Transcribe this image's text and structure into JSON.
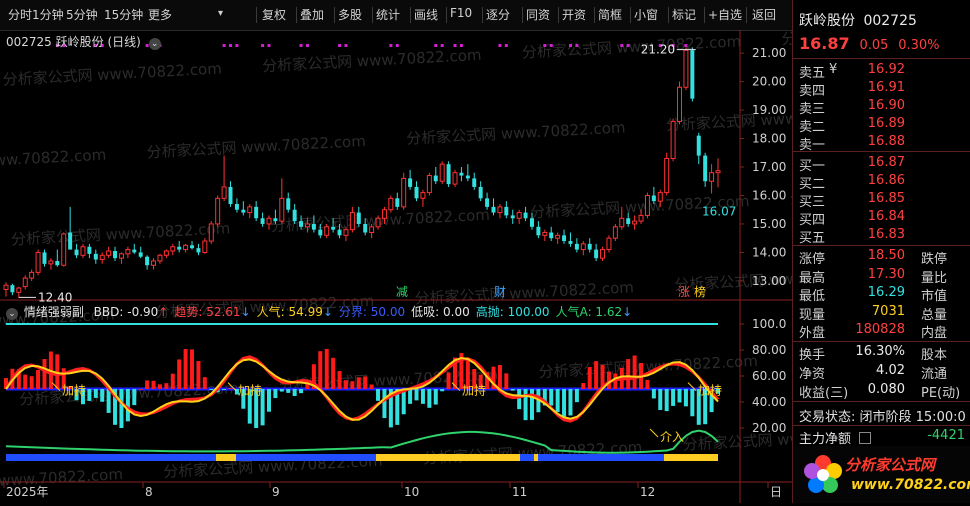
{
  "toolbar": {
    "items": [
      "分时",
      "1分钟",
      "5分钟",
      "15分钟",
      "更多",
      "复权",
      "叠加",
      "多股",
      "统计",
      "画线",
      "F10",
      "逐分",
      "同资",
      "开资",
      "简框",
      "小窗",
      "标记",
      "+自选",
      "返回"
    ],
    "more_arrow": "▾"
  },
  "main_chart": {
    "title": "002725 跃岭股份 (日线)",
    "high_marker": "21.20",
    "low_marker": "12.40",
    "last_marker": "16.07",
    "event_marks": [
      "减",
      "财",
      "涨",
      "榜"
    ],
    "y_ticks": [
      "21.00",
      "20.00",
      "19.00",
      "18.00",
      "17.00",
      "16.00",
      "15.00",
      "14.00",
      "13.00"
    ]
  },
  "indicator": {
    "name": "情绪强弱副",
    "items": [
      {
        "label": "BBD: -0.90",
        "color": "#e6e6e6",
        "arrow": "↑"
      },
      {
        "label": "趋势: 52.61",
        "color": "#ff4040",
        "arrow": "↓"
      },
      {
        "label": "人气: 54.99",
        "color": "#ffd11a",
        "arrow": "↓"
      },
      {
        "label": "分界: 50.00",
        "color": "#3b5bff",
        "arrow": ""
      },
      {
        "label": "低吸: 0.00",
        "color": "#e6e6e6",
        "arrow": ""
      },
      {
        "label": "高抛: 100.00",
        "color": "#33e0e0",
        "arrow": ""
      },
      {
        "label": "人气A: 1.62",
        "color": "#2fd36b",
        "arrow": "↓"
      }
    ],
    "y_ticks": [
      "100.0",
      "80.00",
      "60.00",
      "40.00",
      "20.00"
    ],
    "annotations": [
      "加持",
      "加持",
      "加持",
      "加持",
      "介入"
    ]
  },
  "x_axis": {
    "labels": [
      "2025年",
      "8",
      "9",
      "10",
      "11",
      "12",
      "日"
    ]
  },
  "watermark": "分析家公式网 www.70822.com",
  "sidebar": {
    "name": "跃岭股份",
    "code": "002725",
    "price": "16.87",
    "change": "0.05",
    "change_pct": "0.30%",
    "currency_mark": "¥",
    "sells": [
      {
        "label": "卖五",
        "price": "16.92"
      },
      {
        "label": "卖四",
        "price": "16.91"
      },
      {
        "label": "卖三",
        "price": "16.90"
      },
      {
        "label": "卖二",
        "price": "16.89"
      },
      {
        "label": "卖一",
        "price": "16.88"
      }
    ],
    "buys": [
      {
        "label": "买一",
        "price": "16.87"
      },
      {
        "label": "买二",
        "price": "16.86"
      },
      {
        "label": "买三",
        "price": "16.85"
      },
      {
        "label": "买四",
        "price": "16.84"
      },
      {
        "label": "买五",
        "price": "16.83"
      }
    ],
    "stats": [
      {
        "l1": "涨停",
        "v1": "18.50",
        "c1": "red",
        "l2": "跌停"
      },
      {
        "l1": "最高",
        "v1": "17.30",
        "c1": "red",
        "l2": "量比"
      },
      {
        "l1": "最低",
        "v1": "16.29",
        "c1": "cyan",
        "l2": "市值"
      },
      {
        "l1": "现量",
        "v1": "7031",
        "c1": "yellow",
        "l2": "总量"
      },
      {
        "l1": "外盘",
        "v1": "180828",
        "c1": "red",
        "l2": "内盘"
      }
    ],
    "stats2": [
      {
        "l1": "换手",
        "v1": "16.30%",
        "l2": "股本"
      },
      {
        "l1": "净资",
        "v1": "4.02",
        "l2": "流通"
      },
      {
        "l1": "收益(三)",
        "v1": "0.080",
        "l2": "PE(动)"
      }
    ],
    "trade_status": "交易状态: 闭市阶段 15:00:0",
    "main_flow_label": "主力净额",
    "main_flow_value": "-4421",
    "logo_text": "分析家公式网",
    "logo_url": "www.70822.com"
  },
  "chart_data": {
    "type": "candlestick",
    "ylim": [
      12.4,
      21.6
    ],
    "candles": [
      [
        12.7,
        12.95,
        12.45,
        12.85
      ],
      [
        12.85,
        12.9,
        12.5,
        12.6
      ],
      [
        12.6,
        12.8,
        12.4,
        12.75
      ],
      [
        12.8,
        13.2,
        12.7,
        13.1
      ],
      [
        13.1,
        13.4,
        13.0,
        13.3
      ],
      [
        13.3,
        14.1,
        13.2,
        14.0
      ],
      [
        14.0,
        14.1,
        13.5,
        13.6
      ],
      [
        13.6,
        13.8,
        13.4,
        13.7
      ],
      [
        13.7,
        14.1,
        13.5,
        13.55
      ],
      [
        13.55,
        14.7,
        13.5,
        14.65
      ],
      [
        14.7,
        15.6,
        14.5,
        14.1
      ],
      [
        14.1,
        14.3,
        13.8,
        13.9
      ],
      [
        13.9,
        14.3,
        13.8,
        14.2
      ],
      [
        14.2,
        14.3,
        13.8,
        13.95
      ],
      [
        13.95,
        14.1,
        13.6,
        13.75
      ],
      [
        13.75,
        14.0,
        13.6,
        13.9
      ],
      [
        13.9,
        14.2,
        13.8,
        14.05
      ],
      [
        14.05,
        14.2,
        13.7,
        13.8
      ],
      [
        13.8,
        14.0,
        13.6,
        13.95
      ],
      [
        13.95,
        14.2,
        13.8,
        14.1
      ],
      [
        14.1,
        14.3,
        13.95,
        14.0
      ],
      [
        14.0,
        14.2,
        13.8,
        13.85
      ],
      [
        13.85,
        13.9,
        13.4,
        13.55
      ],
      [
        13.55,
        13.8,
        13.4,
        13.7
      ],
      [
        13.7,
        13.95,
        13.6,
        13.9
      ],
      [
        13.9,
        14.1,
        13.8,
        14.05
      ],
      [
        14.05,
        14.3,
        13.9,
        14.2
      ],
      [
        14.2,
        14.4,
        14.0,
        14.1
      ],
      [
        14.1,
        14.3,
        14.0,
        14.25
      ],
      [
        14.25,
        14.4,
        14.1,
        14.15
      ],
      [
        14.15,
        14.3,
        13.9,
        14.0
      ],
      [
        14.0,
        14.5,
        13.95,
        14.4
      ],
      [
        14.4,
        15.1,
        14.3,
        15.0
      ],
      [
        15.0,
        16.0,
        14.9,
        15.9
      ],
      [
        15.9,
        17.4,
        15.8,
        16.3
      ],
      [
        16.3,
        16.5,
        15.6,
        15.7
      ],
      [
        15.7,
        15.9,
        15.4,
        15.5
      ],
      [
        15.5,
        15.8,
        15.3,
        15.4
      ],
      [
        15.4,
        15.7,
        15.2,
        15.6
      ],
      [
        15.6,
        15.8,
        15.1,
        15.2
      ],
      [
        15.2,
        15.4,
        14.9,
        15.0
      ],
      [
        15.0,
        15.3,
        14.8,
        15.2
      ],
      [
        15.2,
        15.5,
        15.0,
        15.1
      ],
      [
        15.1,
        16.6,
        15.0,
        15.9
      ],
      [
        15.9,
        16.1,
        15.4,
        15.5
      ],
      [
        15.5,
        15.7,
        15.0,
        15.1
      ],
      [
        15.1,
        15.3,
        14.8,
        14.9
      ],
      [
        14.9,
        15.2,
        14.7,
        15.0
      ],
      [
        15.0,
        15.3,
        14.7,
        14.8
      ],
      [
        14.8,
        15.0,
        14.5,
        14.6
      ],
      [
        14.6,
        15.0,
        14.5,
        14.9
      ],
      [
        14.9,
        15.2,
        14.7,
        14.8
      ],
      [
        14.8,
        15.0,
        14.5,
        14.6
      ],
      [
        14.6,
        14.9,
        14.4,
        14.8
      ],
      [
        14.8,
        15.6,
        14.7,
        15.4
      ],
      [
        15.4,
        15.6,
        14.9,
        15.0
      ],
      [
        15.0,
        15.2,
        14.6,
        14.7
      ],
      [
        14.7,
        15.0,
        14.5,
        14.9
      ],
      [
        14.9,
        15.3,
        14.8,
        15.2
      ],
      [
        15.2,
        15.6,
        15.0,
        15.5
      ],
      [
        15.5,
        16.0,
        15.4,
        15.9
      ],
      [
        15.9,
        16.1,
        15.5,
        15.6
      ],
      [
        15.6,
        16.8,
        15.5,
        16.6
      ],
      [
        16.6,
        16.9,
        16.2,
        16.3
      ],
      [
        16.3,
        16.5,
        15.8,
        15.9
      ],
      [
        15.9,
        16.2,
        15.6,
        16.1
      ],
      [
        16.1,
        16.8,
        16.0,
        16.7
      ],
      [
        16.7,
        17.0,
        16.4,
        16.5
      ],
      [
        16.5,
        17.2,
        16.4,
        17.1
      ],
      [
        17.1,
        17.2,
        16.3,
        16.4
      ],
      [
        16.4,
        16.9,
        16.3,
        16.8
      ],
      [
        16.8,
        17.0,
        16.5,
        16.7
      ],
      [
        16.7,
        17.1,
        16.5,
        16.6
      ],
      [
        16.6,
        16.8,
        16.2,
        16.3
      ],
      [
        16.3,
        16.5,
        15.8,
        15.9
      ],
      [
        15.9,
        16.1,
        15.5,
        15.6
      ],
      [
        15.6,
        15.9,
        15.3,
        15.4
      ],
      [
        15.4,
        15.7,
        15.2,
        15.6
      ],
      [
        15.6,
        15.8,
        15.2,
        15.3
      ],
      [
        15.3,
        15.5,
        15.0,
        15.2
      ],
      [
        15.2,
        15.5,
        15.0,
        15.4
      ],
      [
        15.4,
        15.6,
        15.1,
        15.2
      ],
      [
        15.2,
        15.4,
        14.8,
        14.9
      ],
      [
        14.9,
        15.1,
        14.5,
        14.6
      ],
      [
        14.6,
        14.8,
        14.4,
        14.7
      ],
      [
        14.7,
        14.9,
        14.4,
        14.5
      ],
      [
        14.5,
        14.7,
        14.3,
        14.6
      ],
      [
        14.6,
        14.8,
        14.3,
        14.4
      ],
      [
        14.4,
        14.7,
        14.2,
        14.3
      ],
      [
        14.3,
        14.5,
        14.0,
        14.1
      ],
      [
        14.1,
        14.4,
        13.9,
        14.3
      ],
      [
        14.3,
        14.5,
        14.0,
        14.1
      ],
      [
        14.1,
        14.3,
        13.7,
        13.8
      ],
      [
        13.8,
        14.2,
        13.7,
        14.1
      ],
      [
        14.1,
        14.6,
        14.0,
        14.5
      ],
      [
        14.5,
        15.0,
        14.4,
        14.9
      ],
      [
        14.9,
        15.6,
        14.8,
        15.2
      ],
      [
        15.2,
        15.4,
        14.9,
        15.0
      ],
      [
        15.0,
        15.3,
        14.8,
        15.1
      ],
      [
        15.1,
        15.5,
        15.0,
        15.3
      ],
      [
        15.3,
        16.1,
        15.2,
        16.0
      ],
      [
        16.0,
        16.3,
        15.7,
        15.8
      ],
      [
        15.8,
        16.2,
        15.6,
        16.1
      ],
      [
        16.1,
        17.5,
        16.0,
        17.3
      ],
      [
        17.3,
        18.7,
        17.2,
        18.6
      ],
      [
        18.6,
        20.0,
        18.5,
        19.8
      ],
      [
        19.8,
        21.2,
        19.7,
        21.1
      ],
      [
        21.1,
        21.2,
        19.3,
        19.4
      ],
      [
        18.1,
        18.2,
        17.1,
        17.4
      ],
      [
        17.4,
        17.5,
        16.3,
        16.5
      ],
      [
        16.5,
        17.1,
        16.07,
        16.8
      ],
      [
        16.8,
        17.3,
        16.29,
        16.87
      ]
    ]
  }
}
